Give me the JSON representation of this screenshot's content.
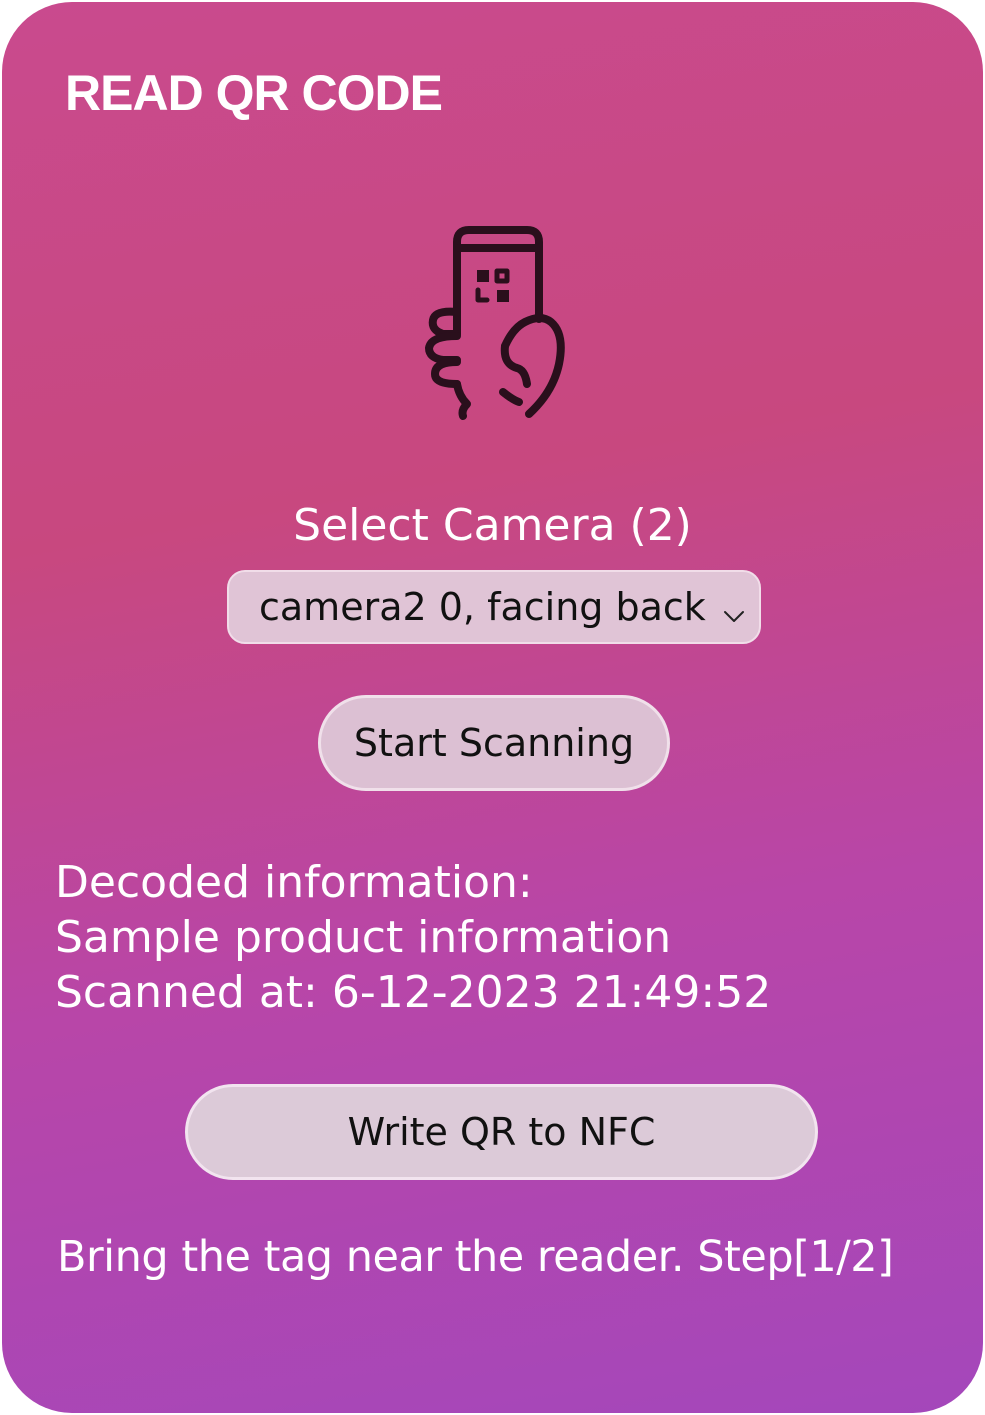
{
  "header": {
    "title": "READ QR CODE"
  },
  "hero": {
    "icon": "phone-scanning-qr-icon",
    "icon_color": "#2a0f1c"
  },
  "camera": {
    "label": "Select Camera (2)",
    "selected": "camera2 0, facing back"
  },
  "actions": {
    "start_label": "Start Scanning",
    "write_nfc_label": "Write QR to NFC"
  },
  "decoded": {
    "heading": "Decoded information:",
    "value": "Sample product information",
    "scanned_at": "Scanned at: 6-12-2023 21:49:52"
  },
  "status": {
    "message": "Bring the tag near the reader.  Step[1/2]"
  },
  "colors": {
    "gradient_top": "#c94a8e",
    "gradient_bottom": "#a447bb",
    "button_fill": "#dcc0d3",
    "text_light": "#ffffff",
    "text_dark": "#111111"
  }
}
